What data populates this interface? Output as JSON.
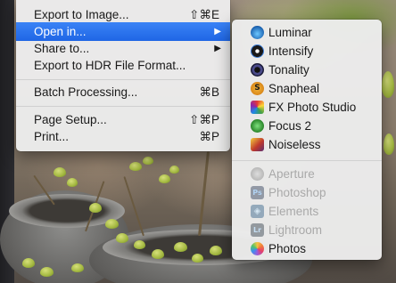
{
  "main_menu": {
    "items": [
      {
        "label": "Export to Image...",
        "shortcut": "⇧⌘E"
      },
      {
        "label": "Open in...",
        "shortcut": "▶"
      },
      {
        "label": "Share to...",
        "shortcut": "▶"
      },
      {
        "label": "Export to HDR File Format...",
        "shortcut": ""
      },
      {
        "label": "Batch Processing...",
        "shortcut": "⌘B"
      },
      {
        "label": "Page Setup...",
        "shortcut": "⇧⌘P"
      },
      {
        "label": "Print...",
        "shortcut": "⌘P"
      }
    ],
    "highlighted_item": "Open in..."
  },
  "submenu": {
    "enabled_items": [
      {
        "label": "Luminar",
        "icon": "luminar-icon"
      },
      {
        "label": "Intensify",
        "icon": "intensify-icon"
      },
      {
        "label": "Tonality",
        "icon": "tonality-icon"
      },
      {
        "label": "Snapheal",
        "icon": "snapheal-icon",
        "glyph": "S"
      },
      {
        "label": "FX Photo Studio",
        "icon": "fx-photo-studio-icon"
      },
      {
        "label": "Focus 2",
        "icon": "focus-2-icon"
      },
      {
        "label": "Noiseless",
        "icon": "noiseless-icon"
      }
    ],
    "disabled_items": [
      {
        "label": "Aperture",
        "icon": "aperture-icon"
      },
      {
        "label": "Photoshop",
        "icon": "photoshop-icon",
        "glyph": "Ps"
      },
      {
        "label": "Elements",
        "icon": "elements-icon",
        "glyph": "◈"
      },
      {
        "label": "Lightroom",
        "icon": "lightroom-icon",
        "glyph": "Lr"
      }
    ],
    "last_item": {
      "label": "Photos",
      "icon": "photos-icon"
    }
  },
  "colors": {
    "highlight": "#1f66e5",
    "menu_background": "#ececec",
    "disabled_text": "#a9a9a9"
  }
}
